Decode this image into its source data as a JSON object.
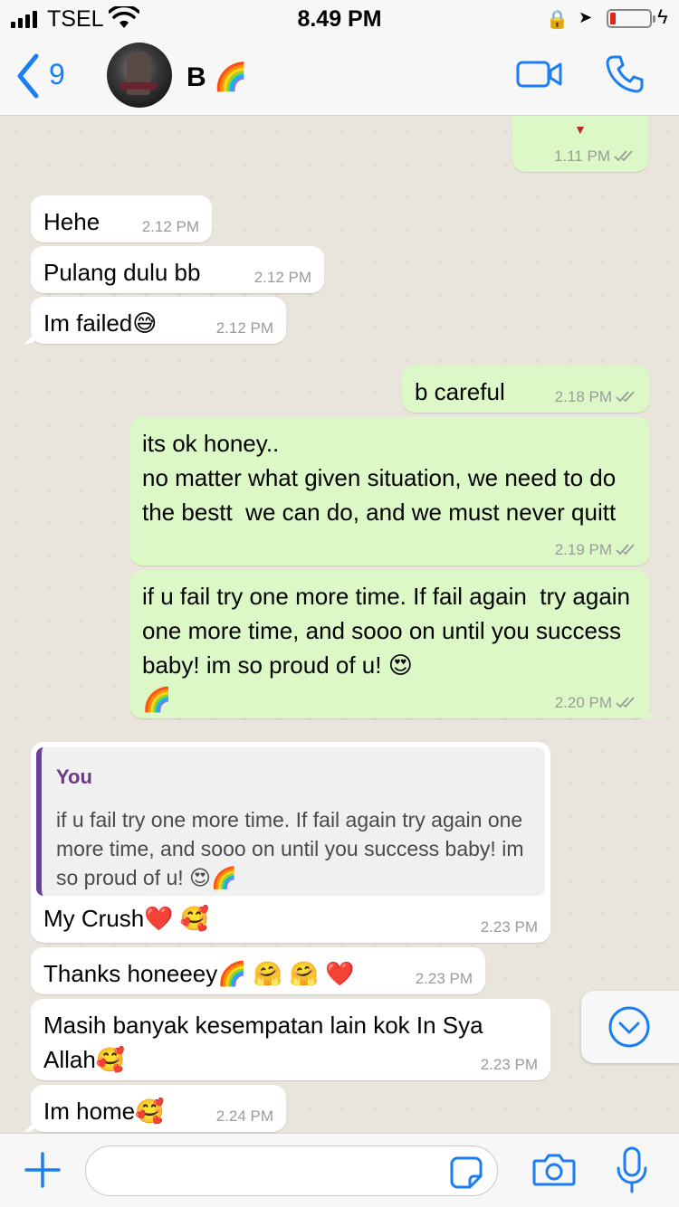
{
  "status_bar": {
    "carrier": "TSEL",
    "time": "8.49 PM",
    "battery_color": "#e1251b"
  },
  "header": {
    "back_count": "9",
    "contact_name": "B 🌈",
    "accent": "#1b7ef3"
  },
  "icons": {
    "back": "chevron-left-icon",
    "video": "video-camera-icon",
    "call": "phone-icon",
    "scroll_down": "chevron-down-circle-icon",
    "plus": "plus-icon",
    "sticker": "sticker-icon",
    "camera": "camera-icon",
    "mic": "microphone-icon"
  },
  "colors": {
    "outgoing_bubble": "#dcf8c6",
    "incoming_bubble": "#ffffff",
    "chat_background": "#e9e4dc",
    "quote_bar": "#6b3fa0"
  },
  "messages": [
    {
      "direction": "out",
      "text": "",
      "time": "1.11 PM",
      "read_ticks": true
    },
    {
      "direction": "in",
      "text": "Hehe",
      "time": "2.12 PM"
    },
    {
      "direction": "in",
      "text": "Pulang dulu bb",
      "time": "2.12 PM"
    },
    {
      "direction": "in",
      "text": "Im failed😅",
      "time": "2.12 PM"
    },
    {
      "direction": "out",
      "text": "b careful",
      "time": "2.18 PM",
      "read_ticks": true
    },
    {
      "direction": "out",
      "text": "its ok honey..\nno matter what given situation, we need to do the bestt  we can do, and we must never quitt",
      "time": "2.19 PM",
      "read_ticks": true
    },
    {
      "direction": "out",
      "text": "if u fail try one more time. If fail again  try again one more time, and sooo on until you success baby! im so proud of u! 😍\n🌈",
      "time": "2.20 PM",
      "read_ticks": true
    },
    {
      "direction": "in",
      "quote_author": "You",
      "quote_text": "if u fail try one more time. If fail again  try again one more time, and sooo on until you success baby! im so proud of u! 😍🌈",
      "text": "My Crush❤️ 🥰",
      "time": "2.23 PM"
    },
    {
      "direction": "in",
      "text": "Thanks honeeey🌈 🤗 🤗 ❤️",
      "time": "2.23 PM"
    },
    {
      "direction": "in",
      "text": "Masih banyak kesempatan lain kok In Sya Allah🥰",
      "time": "2.23 PM"
    },
    {
      "direction": "in",
      "text": "Im home🥰",
      "time": "2.24 PM"
    }
  ],
  "composer": {
    "value": "",
    "placeholder": ""
  }
}
